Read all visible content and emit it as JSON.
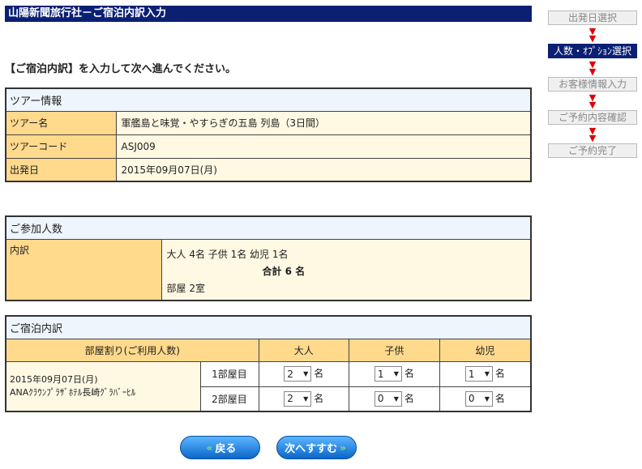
{
  "header": {
    "title": "山陽新聞旅行社－ご宿泊内訳入力"
  },
  "instruction": "【ご宿泊内訳】を入力して次へ進んでください。",
  "tour": {
    "heading": "ツアー情報",
    "rows": [
      {
        "label": "ツアー名",
        "value": "軍艦島と味覚・やすらぎの五島 列島（3日間）"
      },
      {
        "label": "ツアーコード",
        "value": "ASJ009"
      },
      {
        "label": "出発日",
        "value": "2015年09月07日(月)"
      }
    ]
  },
  "people": {
    "heading": "ご参加人数",
    "label": "内訳",
    "breakdown": "大人 4名 子供 1名 幼児 1名",
    "total": "合計 6 名",
    "rooms": "部屋 2室"
  },
  "stay": {
    "heading": "ご宿泊内訳",
    "columns": [
      "部屋割り(ご利用人数)",
      "大人",
      "子供",
      "幼児"
    ],
    "date": "2015年09月07日(月)",
    "hotel": "ANAｸﾗｳﾝﾌﾟﾗｻﾞﾎﾃﾙ長崎ｸﾞﾗﾊﾞｰﾋﾙ",
    "unit": "名",
    "rows": [
      {
        "room": "1部屋目",
        "adult": "2",
        "child": "1",
        "infant": "1"
      },
      {
        "room": "2部屋目",
        "adult": "2",
        "child": "0",
        "infant": "0"
      }
    ]
  },
  "buttons": {
    "back": "戻る",
    "next": "次へすすむ"
  },
  "steps": [
    "出発日選択",
    "人数・ｵﾌﾟｼｮﾝ選択",
    "お客様情報入力",
    "ご予約内容確認",
    "ご予約完了"
  ],
  "active_step": 1
}
